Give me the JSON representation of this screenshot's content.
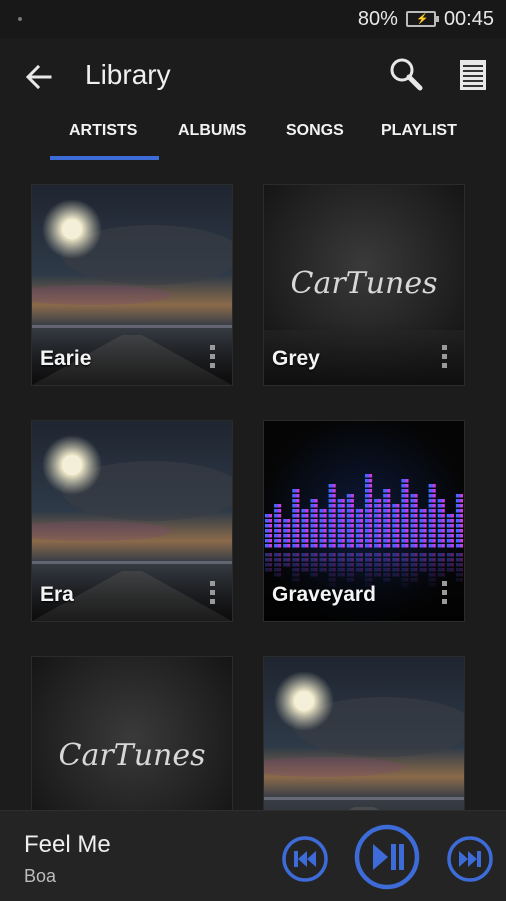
{
  "status_bar": {
    "battery": "80%",
    "time": "00:45"
  },
  "header": {
    "title": "Library"
  },
  "tabs": [
    {
      "label": "ARTISTS",
      "selected": true
    },
    {
      "label": "ALBUMS",
      "selected": false
    },
    {
      "label": "SONGS",
      "selected": false
    },
    {
      "label": "PLAYLIST",
      "selected": false
    }
  ],
  "artists": [
    {
      "name": "Earie",
      "art": "moonlit-road"
    },
    {
      "name": "Grey",
      "art": "car-tunes"
    },
    {
      "name": "Era",
      "art": "moonlit-road"
    },
    {
      "name": "Graveyard",
      "art": "equalizer"
    },
    {
      "name": "",
      "art": "car-tunes"
    },
    {
      "name": "",
      "art": "moonlit-road"
    }
  ],
  "car_tunes_logo": "CarTunes",
  "now_playing": {
    "title": "Feel Me",
    "artist": "Boa"
  },
  "colors": {
    "accent": "#3d6bd8",
    "background": "#1c1c1c"
  }
}
